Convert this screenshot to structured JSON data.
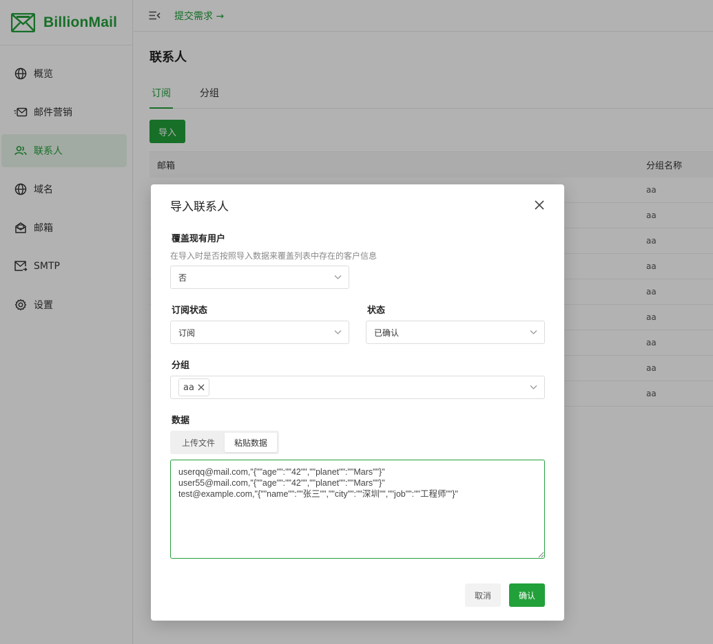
{
  "app": {
    "name": "BillionMail"
  },
  "sidebar": {
    "items": [
      {
        "label": "概览",
        "icon": "globe-icon"
      },
      {
        "label": "邮件营销",
        "icon": "mail-send-icon"
      },
      {
        "label": "联系人",
        "icon": "users-icon",
        "active": true
      },
      {
        "label": "域名",
        "icon": "globe-icon"
      },
      {
        "label": "邮箱",
        "icon": "inbox-icon"
      },
      {
        "label": "SMTP",
        "icon": "mail-forward-icon"
      },
      {
        "label": "设置",
        "icon": "gear-icon"
      }
    ]
  },
  "header": {
    "feedback_link": "提交需求 →"
  },
  "page": {
    "title": "联系人",
    "tabs": [
      "订阅",
      "分组"
    ],
    "import_button": "导入",
    "table": {
      "columns": [
        "邮箱",
        "分组名称"
      ],
      "rows": [
        "aa",
        "aa",
        "aa",
        "aa",
        "aa",
        "aa",
        "aa",
        "aa",
        "aa"
      ]
    }
  },
  "modal": {
    "title": "导入联系人",
    "overwrite": {
      "label": "覆盖现有用户",
      "hint": "在导入时是否按照导入数据来覆盖列表中存在的客户信息",
      "value": "否"
    },
    "subscription_status": {
      "label": "订阅状态",
      "value": "订阅"
    },
    "status": {
      "label": "状态",
      "value": "已确认"
    },
    "group": {
      "label": "分组",
      "tags": [
        "aa"
      ]
    },
    "data": {
      "label": "数据",
      "tabs": [
        "上传文件",
        "粘贴数据"
      ],
      "active_tab": "粘贴数据",
      "content": "userqq@mail.com,\"{\"\"age\"\":\"\"42\"\",\"\"planet\"\":\"\"Mars\"\"}\"\nuser55@mail.com,\"{\"\"age\"\":\"\"42\"\",\"\"planet\"\":\"\"Mars\"\"}\"\ntest@example.com,\"{\"\"name\"\":\"\"张三\"\",\"\"city\"\":\"\"深圳\"\",\"\"job\"\":\"\"工程师\"\"}\""
    },
    "cancel_button": "取消",
    "confirm_button": "确认"
  },
  "colors": {
    "accent": "#22a03a",
    "active_bg": "#e8f5ea"
  }
}
